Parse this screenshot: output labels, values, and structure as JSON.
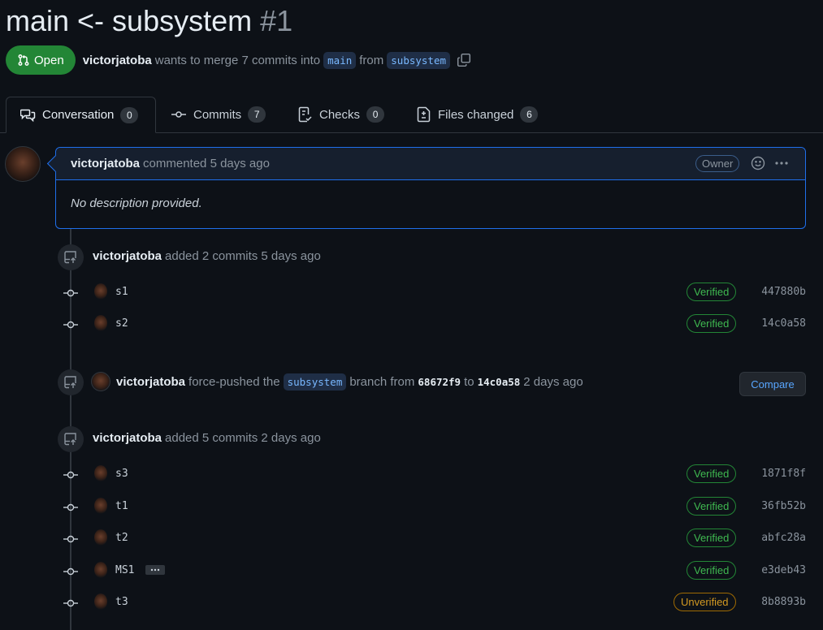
{
  "pr": {
    "title": "main <- subsystem",
    "number": "#1",
    "state": "Open",
    "author": "victorjatoba",
    "merge_text_1": "wants to merge 7 commits into",
    "base_branch": "main",
    "merge_text_2": "from",
    "head_branch": "subsystem"
  },
  "tabs": [
    {
      "label": "Conversation",
      "count": "0"
    },
    {
      "label": "Commits",
      "count": "7"
    },
    {
      "label": "Checks",
      "count": "0"
    },
    {
      "label": "Files changed",
      "count": "6"
    }
  ],
  "comment": {
    "author": "victorjatoba",
    "meta": "commented 5 days ago",
    "badge": "Owner",
    "body": "No description provided."
  },
  "events": [
    {
      "author": "victorjatoba",
      "text": "added 2 commits 5 days ago",
      "commits": [
        {
          "msg": "s1",
          "status": "Verified",
          "sha": "447880b"
        },
        {
          "msg": "s2",
          "status": "Verified",
          "sha": "14c0a58"
        }
      ]
    },
    {
      "author": "victorjatoba",
      "text_1": "force-pushed the",
      "branch": "subsystem",
      "text_2": "branch from",
      "from_sha": "68672f9",
      "text_3": "to",
      "to_sha": "14c0a58",
      "text_4": "2 days ago",
      "button": "Compare"
    },
    {
      "author": "victorjatoba",
      "text": "added 5 commits 2 days ago",
      "commits": [
        {
          "msg": "s3",
          "status": "Verified",
          "sha": "1871f8f"
        },
        {
          "msg": "t1",
          "status": "Verified",
          "sha": "36fb52b"
        },
        {
          "msg": "t2",
          "status": "Verified",
          "sha": "abfc28a"
        },
        {
          "msg": "MS1",
          "status": "Verified",
          "sha": "e3deb43"
        },
        {
          "msg": "t3",
          "status": "Unverified",
          "sha": "8b8893b"
        }
      ]
    }
  ],
  "colors": {
    "background": "#0d1117",
    "open_green": "#238636",
    "verified_green": "#3fb950",
    "unverified_amber": "#d29922",
    "link_blue": "#58a6ff"
  },
  "icons": [
    "git-pull-request-icon",
    "copy-icon",
    "conversation-icon",
    "commit-icon",
    "checklist-icon",
    "file-diff-icon",
    "smiley-icon",
    "kebab-horizontal-icon",
    "repo-push-icon"
  ]
}
